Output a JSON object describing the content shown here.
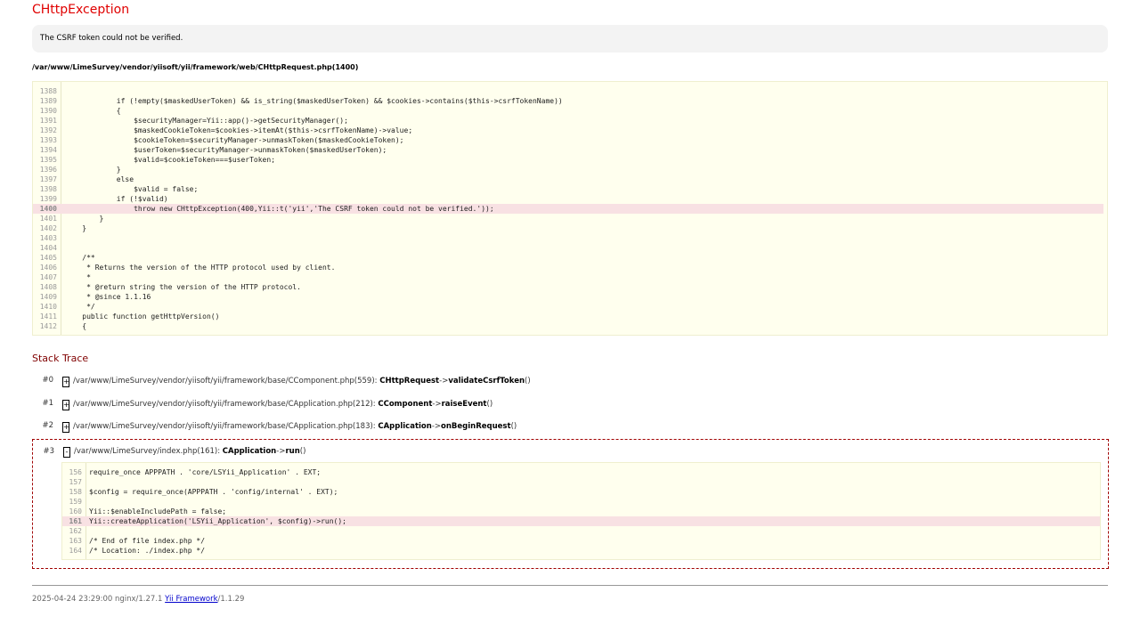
{
  "exception": {
    "title": "CHttpException",
    "message": "The CSRF token could not be verified.",
    "file": "/var/www/LimeSurvey/vendor/yiisoft/yii/framework/web/CHttpRequest.php(1400)"
  },
  "source": {
    "lines": [
      {
        "n": "1388",
        "code": "",
        "err": false
      },
      {
        "n": "1389",
        "code": "            if (!empty($maskedUserToken) && is_string($maskedUserToken) && $cookies->contains($this->csrfTokenName))",
        "err": false
      },
      {
        "n": "1390",
        "code": "            {",
        "err": false
      },
      {
        "n": "1391",
        "code": "                $securityManager=Yii::app()->getSecurityManager();",
        "err": false
      },
      {
        "n": "1392",
        "code": "                $maskedCookieToken=$cookies->itemAt($this->csrfTokenName)->value;",
        "err": false
      },
      {
        "n": "1393",
        "code": "                $cookieToken=$securityManager->unmaskToken($maskedCookieToken);",
        "err": false
      },
      {
        "n": "1394",
        "code": "                $userToken=$securityManager->unmaskToken($maskedUserToken);",
        "err": false
      },
      {
        "n": "1395",
        "code": "                $valid=$cookieToken===$userToken;",
        "err": false
      },
      {
        "n": "1396",
        "code": "            }",
        "err": false
      },
      {
        "n": "1397",
        "code": "            else",
        "err": false
      },
      {
        "n": "1398",
        "code": "                $valid = false;",
        "err": false
      },
      {
        "n": "1399",
        "code": "            if (!$valid)",
        "err": false
      },
      {
        "n": "1400",
        "code": "                throw new CHttpException(400,Yii::t('yii','The CSRF token could not be verified.'));",
        "err": true
      },
      {
        "n": "1401",
        "code": "        }",
        "err": false
      },
      {
        "n": "1402",
        "code": "    }",
        "err": false
      },
      {
        "n": "1403",
        "code": "",
        "err": false
      },
      {
        "n": "1404",
        "code": "",
        "err": false
      },
      {
        "n": "1405",
        "code": "    /**",
        "err": false
      },
      {
        "n": "1406",
        "code": "     * Returns the version of the HTTP protocol used by client.",
        "err": false
      },
      {
        "n": "1407",
        "code": "     *",
        "err": false
      },
      {
        "n": "1408",
        "code": "     * @return string the version of the HTTP protocol.",
        "err": false
      },
      {
        "n": "1409",
        "code": "     * @since 1.1.16",
        "err": false
      },
      {
        "n": "1410",
        "code": "     */",
        "err": false
      },
      {
        "n": "1411",
        "code": "    public function getHttpVersion()",
        "err": false
      },
      {
        "n": "1412",
        "code": "    {",
        "err": false
      }
    ]
  },
  "stack": {
    "title": "Stack Trace",
    "items": [
      {
        "num": "#0",
        "toggle": "+",
        "file": "/var/www/LimeSurvey/vendor/yiisoft/yii/framework/base/CComponent.php(559):",
        "cls": "CHttpRequest",
        "arrow": "->",
        "method": "validateCsrfToken",
        "parens": "()"
      },
      {
        "num": "#1",
        "toggle": "+",
        "file": "/var/www/LimeSurvey/vendor/yiisoft/yii/framework/base/CApplication.php(212):",
        "cls": "CComponent",
        "arrow": "->",
        "method": "raiseEvent",
        "parens": "()"
      },
      {
        "num": "#2",
        "toggle": "+",
        "file": "/var/www/LimeSurvey/vendor/yiisoft/yii/framework/base/CApplication.php(183):",
        "cls": "CApplication",
        "arrow": "->",
        "method": "onBeginRequest",
        "parens": "()"
      },
      {
        "num": "#3",
        "toggle": "-",
        "file": "/var/www/LimeSurvey/index.php(161):",
        "cls": "CApplication",
        "arrow": "->",
        "method": "run",
        "parens": "()"
      }
    ],
    "expanded_source": [
      {
        "n": "156",
        "code": "require_once APPPATH . 'core/LSYii_Application' . EXT;",
        "err": false
      },
      {
        "n": "157",
        "code": "",
        "err": false
      },
      {
        "n": "158",
        "code": "$config = require_once(APPPATH . 'config/internal' . EXT);",
        "err": false
      },
      {
        "n": "159",
        "code": "",
        "err": false
      },
      {
        "n": "160",
        "code": "Yii::$enableIncludePath = false;",
        "err": false
      },
      {
        "n": "161",
        "code": "Yii::createApplication('LSYii_Application', $config)->run();",
        "err": true
      },
      {
        "n": "162",
        "code": "",
        "err": false
      },
      {
        "n": "163",
        "code": "/* End of file index.php */",
        "err": false
      },
      {
        "n": "164",
        "code": "/* Location: ./index.php */",
        "err": false
      }
    ]
  },
  "footer": {
    "prefix": "2025-04-24 23:29:00 nginx/1.27.1",
    "link": "Yii Framework",
    "suffix": "/1.1.29"
  }
}
